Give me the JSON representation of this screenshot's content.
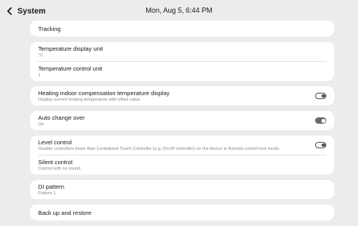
{
  "header": {
    "title": "System",
    "datetime": "Mon, Aug 5, 6:44 PM"
  },
  "sections": {
    "tracking": {
      "label": "Tracking"
    },
    "temperature": {
      "display_unit": {
        "label": "Temperature display unit",
        "value": "°C"
      },
      "control_unit": {
        "label": "Temperature control unit",
        "value": "1"
      }
    },
    "heating_compensation": {
      "label": "Heating indoor compensation temperature display",
      "description": "Display current heating temperature with offset value.",
      "enabled": false
    },
    "auto_change_over": {
      "label": "Auto change over",
      "value": "On",
      "enabled": true
    },
    "level_control": {
      "label": "Level control",
      "description": "Disable controllers lower than Centralized Touch Controller (e.g. On/off controller) on the device in Remote control lock mode.",
      "enabled": false
    },
    "silent_control": {
      "label": "Silent control",
      "description": "Control with no sound."
    },
    "di_pattern": {
      "label": "DI pattern",
      "value": "Pattern 1"
    },
    "backup": {
      "label": "Back up and restore"
    }
  },
  "icons": {
    "back": "chevron-left-icon"
  },
  "colors": {
    "background": "#ececec",
    "card": "#ffffff",
    "toggle_on": "#6b6b6b",
    "toggle_off_border": "#555555"
  }
}
